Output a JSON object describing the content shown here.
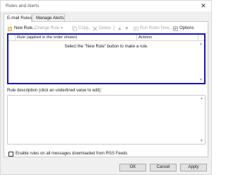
{
  "window": {
    "title": "Rules and Alerts",
    "close_glyph": "✕"
  },
  "tabs": [
    {
      "label": "E-mail Rules",
      "active": true
    },
    {
      "label": "Manage Alerts",
      "active": false
    }
  ],
  "toolbar": {
    "new_rule": "New Rule...",
    "change_rule": "Change Rule ▾",
    "copy": "Copy...",
    "delete": "Delete",
    "up_glyph": "▲",
    "down_glyph": "▼",
    "run_rules": "Run Rules Now...",
    "options": "Options"
  },
  "rules_list": {
    "columns": [
      "Rule (applied in the order shown)",
      "Actions"
    ],
    "empty_message": "Select the \"New Rule\" button to make a rule.",
    "selection_border_color": "#1515c8"
  },
  "description": {
    "label": "Rule description (click an underlined value to edit):"
  },
  "rss": {
    "label": "Enable rules on all messages downloaded from RSS Feeds",
    "checked": false
  },
  "buttons": {
    "ok": "OK",
    "cancel": "Cancel",
    "apply": "Apply"
  },
  "icons": {
    "new_rule": "new-rule-icon",
    "change_rule": "change-rule-icon",
    "copy": "copy-icon",
    "delete": "delete-icon",
    "run_rules": "run-rules-icon",
    "options": "options-icon"
  }
}
